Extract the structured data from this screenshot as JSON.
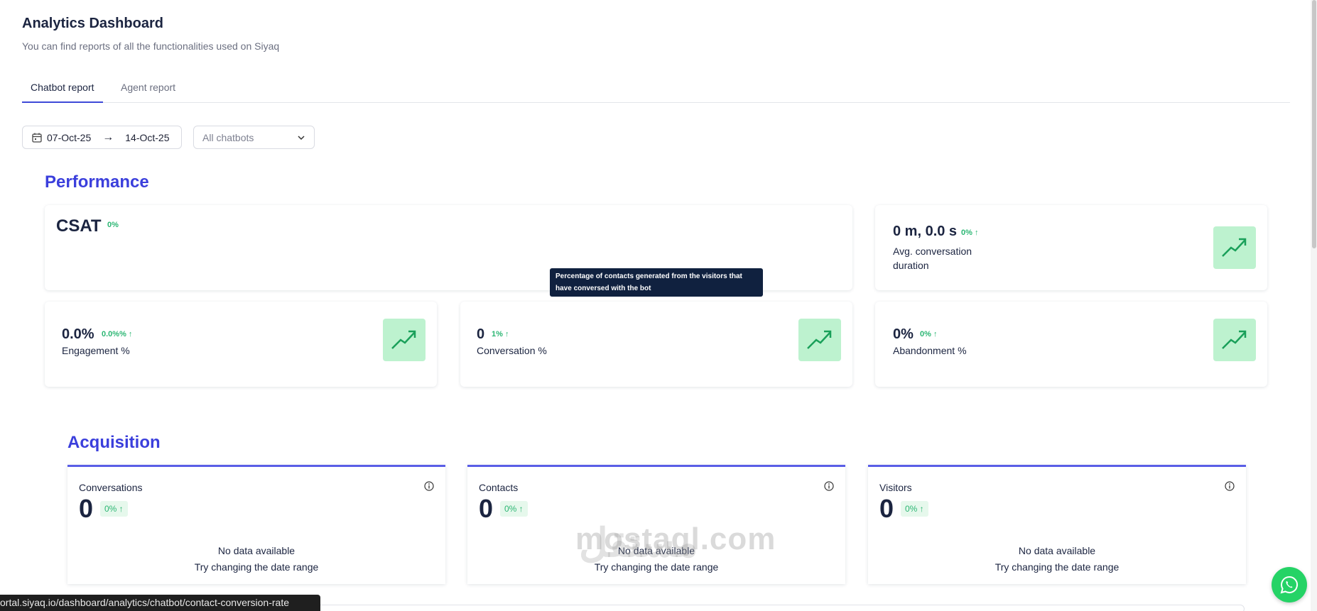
{
  "header": {
    "title": "Analytics Dashboard",
    "subtitle": "You can find reports of all the functionalities used on Siyaq"
  },
  "tabs": [
    {
      "label": "Chatbot report",
      "active": true
    },
    {
      "label": "Agent report",
      "active": false
    }
  ],
  "filters": {
    "date_from": "07-Oct-25",
    "date_to": "14-Oct-25",
    "chatbot_select": "All chatbots"
  },
  "performance": {
    "title": "Performance",
    "csat": {
      "label": "CSAT",
      "delta": "0%"
    },
    "avg_duration": {
      "value": "0 m, 0.0 s",
      "delta": "0%",
      "label": "Avg. conversation duration"
    },
    "engagement": {
      "value": "0.0%",
      "delta": "0.0%%",
      "label": "Engagement %"
    },
    "conversation": {
      "value": "0",
      "delta": "1%",
      "label": "Conversation %"
    },
    "abandonment": {
      "value": "0%",
      "delta": "0%",
      "label": "Abandonment %"
    },
    "tooltip": "Percentage of contacts generated from the visitors that have conversed with the bot"
  },
  "acquisition": {
    "title": "Acquisition",
    "cards": [
      {
        "label": "Conversations",
        "value": "0",
        "delta": "0%",
        "nodata": "No data available",
        "hint": "Try changing the date range"
      },
      {
        "label": "Contacts",
        "value": "0",
        "delta": "0%",
        "nodata": "No data available",
        "hint": "Try changing the date range"
      },
      {
        "label": "Visitors",
        "value": "0",
        "delta": "0%",
        "nodata": "No data available",
        "hint": "Try changing the date range"
      }
    ]
  },
  "watermark": {
    "latin": "mostaql.com",
    "arabic": "مستقل"
  },
  "statusbar": {
    "url": "ortal.siyaq.io/dashboard/analytics/chatbot/contact-conversion-rate"
  },
  "colors": {
    "accent": "#3b3fdc",
    "positive": "#2bb673",
    "icon_bg": "#bdf2cf",
    "tooltip_bg": "#10213f",
    "whatsapp": "#25d366"
  }
}
